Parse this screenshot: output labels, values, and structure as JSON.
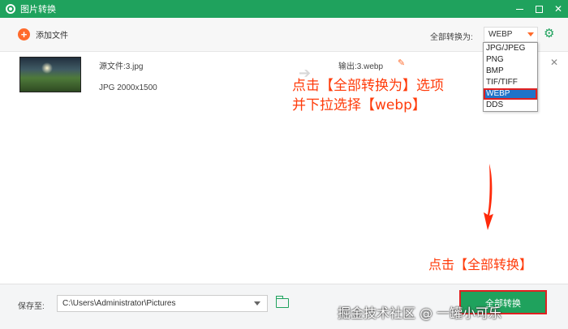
{
  "window": {
    "title": "图片转换"
  },
  "toolbar": {
    "add_label": "添加文件",
    "convert_all_label": "全部转换为:",
    "format_selected": "WEBP"
  },
  "dropdown": {
    "options": [
      "JPG/JPEG",
      "PNG",
      "BMP",
      "TIF/TIFF",
      "WEBP",
      "DDS"
    ]
  },
  "file": {
    "source": "源文件:3.jpg",
    "meta": "JPG   2000x1500",
    "output": "输出:3.webp"
  },
  "annotations": {
    "line1": "点击【全部转换为】选项",
    "line2": "并下拉选择【webp】",
    "convert_hint": "点击【全部转换】"
  },
  "bottom": {
    "save_label": "保存至:",
    "path": "C:\\Users\\Administrator\\Pictures",
    "convert_button": "全部转换"
  },
  "watermark": "掘金技术社区 @ 一罐小可乐",
  "colors": {
    "accent": "#1fa25d",
    "orange": "#ff6a2b",
    "annotation": "#ff3b0a"
  }
}
